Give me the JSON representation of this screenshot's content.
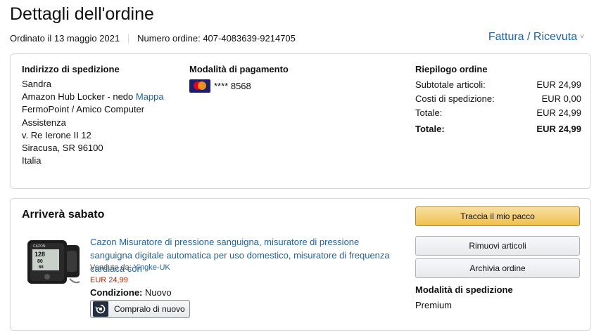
{
  "page": {
    "title": "Dettagli dell'ordine",
    "order_date": "Ordinato il 13 maggio 2021",
    "order_number": "Numero ordine: 407-4083639-9214705",
    "invoice_link": "Fattura / Ricevuta",
    "invoice_chevron": "˅"
  },
  "shipping_address": {
    "heading": "Indirizzo di spedizione",
    "lines": [
      "Sandra",
      "Amazon Hub Locker - nedo",
      "FermoPoint / Amico Computer",
      "Assistenza",
      "v. Re Ierone II 12",
      "Siracusa, SR 96100",
      "Italia"
    ],
    "map_link": "Mappa"
  },
  "payment": {
    "heading": "Modalità di pagamento",
    "card_icon": "mastercard-icon",
    "card_text": "**** 8568"
  },
  "summary": {
    "heading": "Riepilogo ordine",
    "rows": [
      {
        "label": "Subtotale articoli:",
        "value": "EUR 24,99"
      },
      {
        "label": "Costi di spedizione:",
        "value": "EUR 0,00"
      },
      {
        "label": "Totale:",
        "value": "EUR 24,99"
      },
      {
        "label": "Totale:",
        "value": "EUR 24,99"
      }
    ]
  },
  "shipment": {
    "heading": "Arriverà sabato",
    "product_title": "Cazon Misuratore di pressione sanguigna, misuratore di pressione sanguigna digitale automatica per uso domestico, misuratore di frequenza cardiaca con",
    "seller_label": "Venduto da:",
    "seller_name": "Yingke-UK",
    "price": "EUR 24,99",
    "condition_label": "Condizione:",
    "condition_value": "Nuovo",
    "buy_again": "Compralo di nuovo",
    "thumb_brand": "CAZON",
    "thumb_readings": [
      "128",
      "80",
      "68"
    ],
    "buttons": {
      "track": "Traccia il mio pacco",
      "remove": "Rimuovi articoli",
      "archive": "Archivia ordine"
    },
    "shipping_method_label": "Modalità di spedizione",
    "shipping_method_value": "Premium"
  }
}
